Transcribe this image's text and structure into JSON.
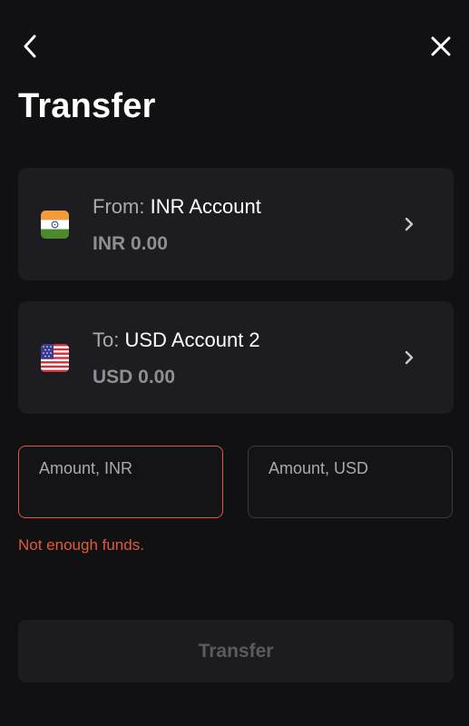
{
  "header": {
    "title": "Transfer",
    "back_icon": "chevron-left-icon",
    "close_icon": "close-icon"
  },
  "from_account": {
    "prefix": "From:",
    "name": "INR Account",
    "balance": "INR 0.00",
    "flag": "india-flag-icon"
  },
  "to_account": {
    "prefix": "To:",
    "name": "USD Account 2",
    "balance": "USD 0.00",
    "flag": "usa-flag-icon"
  },
  "amount_from": {
    "label": "Amount, INR",
    "value": ""
  },
  "amount_to": {
    "label": "Amount, USD",
    "value": ""
  },
  "error": "Not enough funds.",
  "transfer_button": {
    "label": "Transfer",
    "enabled": false
  },
  "colors": {
    "background": "#111113",
    "card": "#1d1d21",
    "error": "#e25a3c",
    "muted_text": "#8e8e93"
  }
}
